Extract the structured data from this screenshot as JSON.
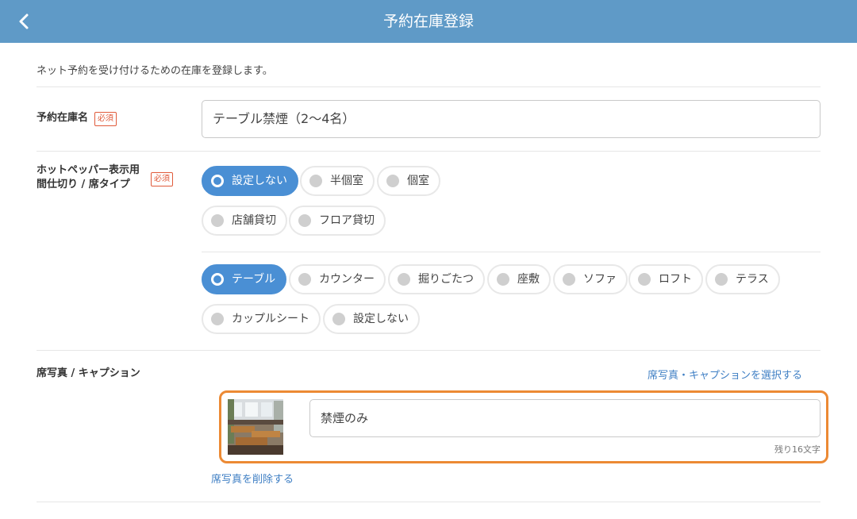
{
  "header": {
    "title": "予約在庫登録",
    "back_icon": "chevron-left-icon"
  },
  "intro": "ネット予約を受け付けるための在庫を登録します。",
  "required_label": "必須",
  "stock_name": {
    "label": "予約在庫名",
    "value": "テーブル禁煙（2〜4名）"
  },
  "seat_type": {
    "label_line1": "ホットペッパー表示用",
    "label_line2": "間仕切り / 席タイプ",
    "partition_options": [
      "設定しない",
      "半個室",
      "個室",
      "店舗貸切",
      "フロア貸切"
    ],
    "partition_selected": "設定しない",
    "seat_options": [
      "テーブル",
      "カウンター",
      "掘りごたつ",
      "座敷",
      "ソファ",
      "ロフト",
      "テラス",
      "カップルシート",
      "設定しない"
    ],
    "seat_selected": "テーブル"
  },
  "photo": {
    "label": "席写真 / キャプション",
    "select_link": "席写真・キャプションを選択する",
    "caption_value": "禁煙のみ",
    "remaining": "残り16文字",
    "delete_link": "席写真を削除する"
  },
  "colors": {
    "header": "#5f9ac7",
    "selected": "#4a8fd4",
    "highlight": "#ec8a34",
    "required": "#e05a3a",
    "link": "#3f7fc4"
  }
}
